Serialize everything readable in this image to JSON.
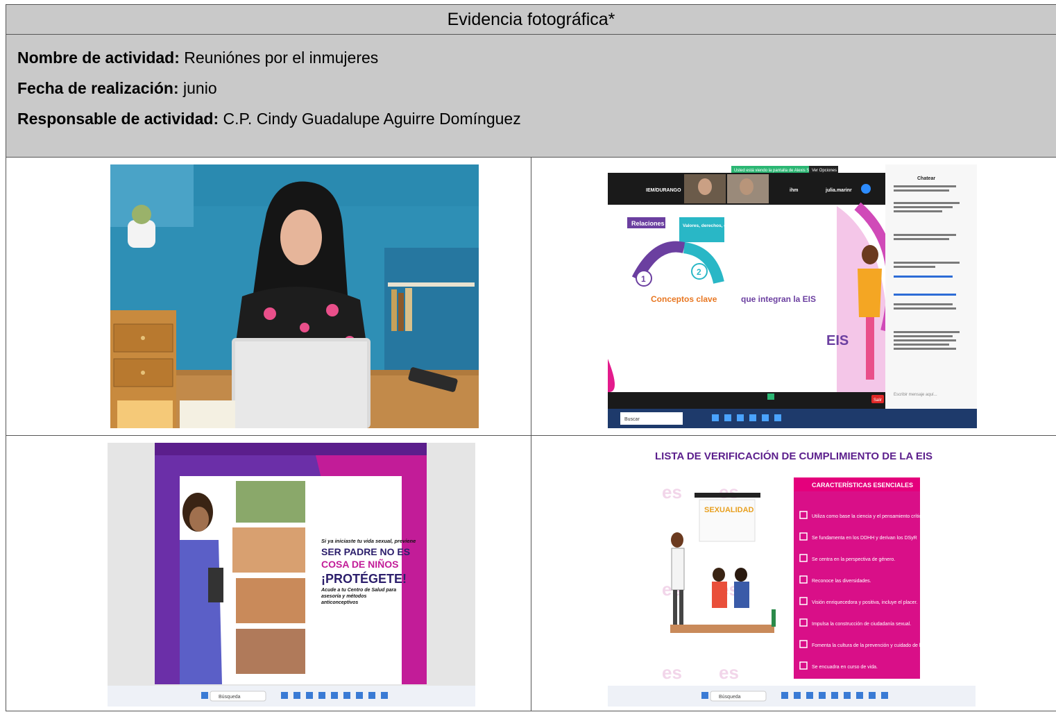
{
  "header": {
    "title": "Evidencia fotográfica*"
  },
  "activity": {
    "name_label": "Nombre de actividad:",
    "name_value": "Reuniónes por el inmujeres",
    "date_label": "Fecha de realización:",
    "date_value": "junio",
    "owner_label": "Responsable de actividad:",
    "owner_value": "C.P. Cindy Guadalupe Aguirre Domínguez"
  },
  "photo2": {
    "participants": [
      "IEM/DURANGO",
      "",
      "",
      "ihm",
      "julia.marinr"
    ],
    "share_banner": "Usted está viendo la pantalla de Alexis Sierra",
    "view_options": "Ver Opciones",
    "chat_title": "Chatear",
    "slide_tag": "Relaciones",
    "slide_tag2": "Valores, derechos, cultura y sexualidad",
    "slide_num1": "1",
    "slide_num2": "2",
    "slide_concepts": "Conceptos clave",
    "slide_integran": "que integran la EIS",
    "slide_logo": "EIS",
    "leave_button": "Salir",
    "search": "Buscar",
    "chat_placeholder": "Escribir mensaje aquí..."
  },
  "photo3": {
    "line1": "Si ya iniciaste tu vida sexual, previene",
    "line2": "SER PADRE NO ES",
    "line3": "COSA DE NIÑOS",
    "line4": "¡PROTÉGETE!",
    "line5": "Acude a tu Centro de Salud para asesoría y métodos anticonceptivos",
    "search": "Búsqueda"
  },
  "photo4": {
    "title": "LISTA DE VERIFICACIÓN DE CUMPLIMIENTO DE LA EIS",
    "panel_title": "CARACTERÍSTICAS ESENCIALES",
    "sign": "SEXUALIDAD",
    "items": [
      "Utiliza como base la ciencia y el pensamiento crítico.",
      "Se fundamenta en los DDHH y derivan los DSyR",
      "Se centra en la perspectiva de género.",
      "Reconoce las diversidades.",
      "Visión enriquecedora y positiva, incluye el placer.",
      "Impulsa la construcción de ciudadanía sexual.",
      "Fomenta la cultura de la prevención y cuidado de la DSyR",
      "Se encuadra en curso de vida."
    ],
    "search": "Búsqueda"
  },
  "colors": {
    "header_bg": "#c9c9c9",
    "magenta": "#e4007c",
    "purple": "#5b1e8c",
    "teal": "#29b7c6"
  }
}
